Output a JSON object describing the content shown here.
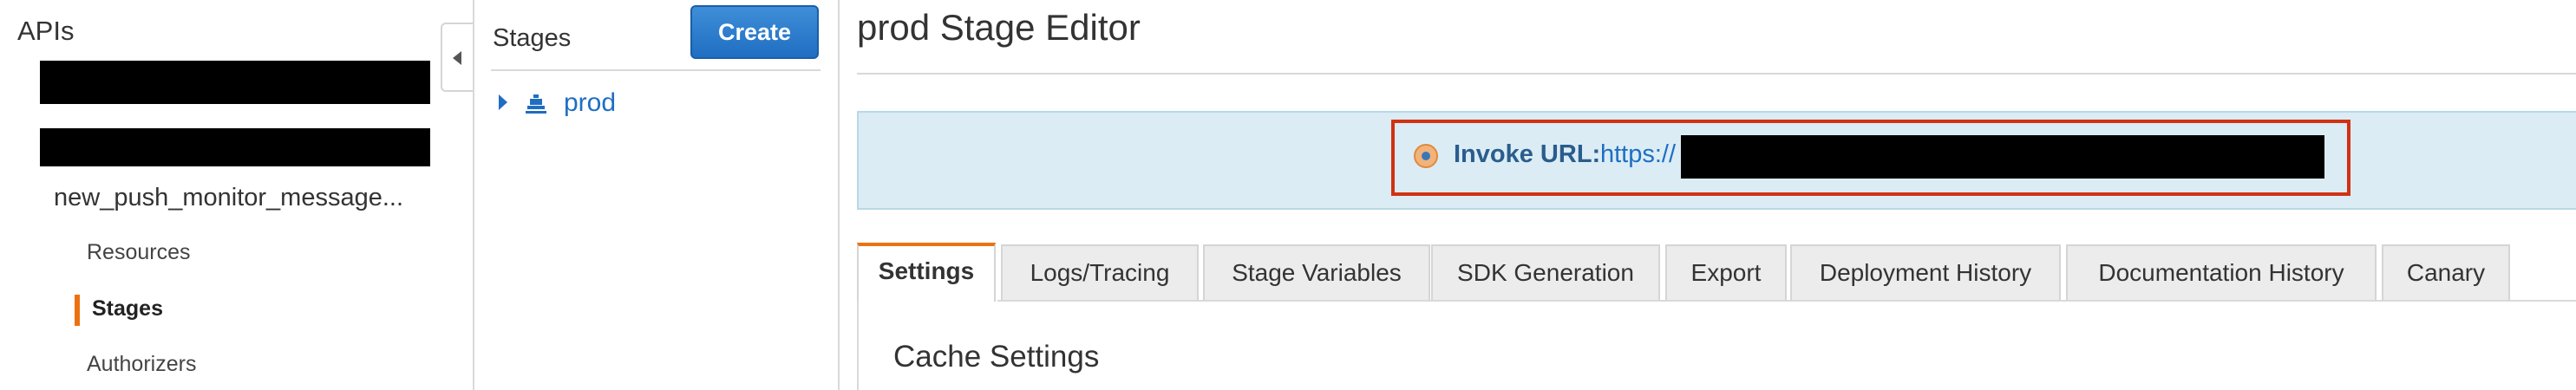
{
  "left_nav": {
    "title": "APIs",
    "api_name": "new_push_monitor_message...",
    "items": [
      {
        "label": "Resources",
        "active": false
      },
      {
        "label": "Stages",
        "active": true
      },
      {
        "label": "Authorizers",
        "active": false
      }
    ]
  },
  "stages_panel": {
    "title": "Stages",
    "create_label": "Create",
    "stages": [
      {
        "label": "prod"
      }
    ]
  },
  "main": {
    "title": "prod Stage Editor",
    "invoke_url_label": "Invoke URL:",
    "invoke_url_prefix": "https://",
    "tabs": [
      {
        "label": "Settings",
        "active": true
      },
      {
        "label": "Logs/Tracing",
        "active": false
      },
      {
        "label": "Stage Variables",
        "active": false
      },
      {
        "label": "SDK Generation",
        "active": false
      },
      {
        "label": "Export",
        "active": false
      },
      {
        "label": "Deployment History",
        "active": false
      },
      {
        "label": "Documentation History",
        "active": false
      },
      {
        "label": "Canary",
        "active": false
      }
    ],
    "section_title": "Cache Settings"
  },
  "colors": {
    "accent": "#ec7211",
    "link": "#1f6ec2",
    "banner_bg": "#dbecf5",
    "highlight": "#d13212",
    "button": "#1f6ec2"
  }
}
